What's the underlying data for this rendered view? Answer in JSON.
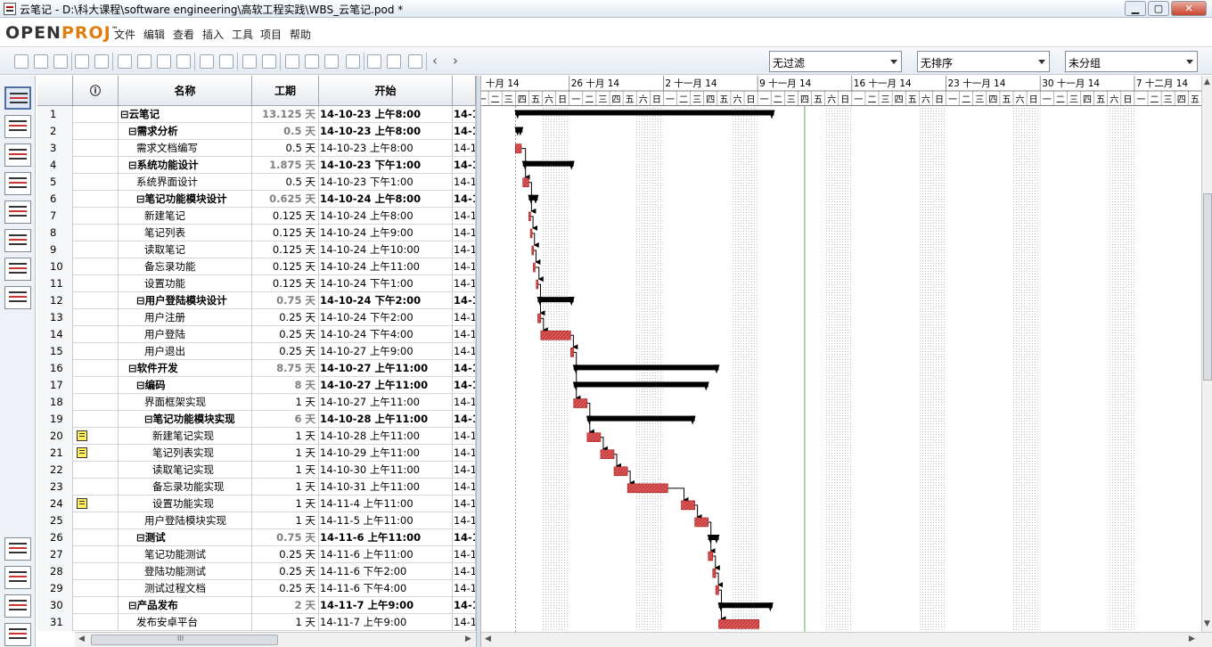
{
  "window": {
    "title": "云笔记 - D:\\科大课程\\software engineering\\高软工程实践\\WBS_云笔记.pod *",
    "min": "▁",
    "max": "▢",
    "close": "✕"
  },
  "app": {
    "logo_main": "OPEN",
    "logo_accent": "PROJ",
    "logo_tm": "™"
  },
  "menu": [
    "文件",
    "编辑",
    "查看",
    "插入",
    "工具",
    "项目",
    "帮助"
  ],
  "toolbar": {
    "filter": "无过滤",
    "sort": "无排序",
    "group": "未分组",
    "icons": [
      "new-file-icon",
      "open-folder-icon",
      "save-icon",
      "print-icon",
      "print-preview-icon",
      "cut-icon",
      "copy-icon",
      "paste-icon",
      "find-icon",
      "undo-icon",
      "redo-icon",
      "link-icon",
      "unlink-icon",
      "task-info-icon",
      "notes-icon",
      "assign-resource-icon",
      "calendar-icon",
      "zoom-in-icon",
      "zoom-out-icon",
      "scroll-to-task-icon"
    ],
    "prev": "‹",
    "next": "›"
  },
  "sidebar": [
    "gantt-view-icon",
    "network-view-icon",
    "resource-view-icon",
    "wbs-view-icon",
    "rbs-view-icon",
    "project-view-icon",
    "task-usage-icon",
    "resource-usage-icon",
    "histogram-icon",
    "charts-icon",
    "task-usage-detail-icon",
    "resource-usage-detail-icon"
  ],
  "table": {
    "headers": {
      "indicator": "ⓘ",
      "name": "名称",
      "duration": "工期",
      "start": "开始"
    },
    "rows": [
      {
        "id": "1",
        "name": "⊟云笔记",
        "indent": 0,
        "summary": true,
        "dur": "13.125 天",
        "start": "14-10-23 上午8:00",
        "finish": "14-1"
      },
      {
        "id": "2",
        "name": "⊟需求分析",
        "indent": 1,
        "summary": true,
        "dur": "0.5 天",
        "start": "14-10-23 上午8:00",
        "finish": "14-1"
      },
      {
        "id": "3",
        "name": "需求文档编写",
        "indent": 2,
        "dur": "0.5 天",
        "start": "14-10-23 上午8:00",
        "finish": "14-1"
      },
      {
        "id": "4",
        "name": "⊟系统功能设计",
        "indent": 1,
        "summary": true,
        "dur": "1.875 天",
        "start": "14-10-23 下午1:00",
        "finish": "14-1"
      },
      {
        "id": "5",
        "name": "系统界面设计",
        "indent": 2,
        "dur": "0.5 天",
        "start": "14-10-23 下午1:00",
        "finish": "14-1"
      },
      {
        "id": "6",
        "name": "⊟笔记功能模块设计",
        "indent": 2,
        "summary": true,
        "dur": "0.625 天",
        "start": "14-10-24 上午8:00",
        "finish": "14-1"
      },
      {
        "id": "7",
        "name": "新建笔记",
        "indent": 3,
        "dur": "0.125 天",
        "start": "14-10-24 上午8:00",
        "finish": "14-1"
      },
      {
        "id": "8",
        "name": "笔记列表",
        "indent": 3,
        "dur": "0.125 天",
        "start": "14-10-24 上午9:00",
        "finish": "14-1"
      },
      {
        "id": "9",
        "name": "读取笔记",
        "indent": 3,
        "dur": "0.125 天",
        "start": "14-10-24 上午10:00",
        "finish": "14-1"
      },
      {
        "id": "10",
        "name": "备忘录功能",
        "indent": 3,
        "dur": "0.125 天",
        "start": "14-10-24 上午11:00",
        "finish": "14-1"
      },
      {
        "id": "11",
        "name": "设置功能",
        "indent": 3,
        "dur": "0.125 天",
        "start": "14-10-24 下午1:00",
        "finish": "14-1"
      },
      {
        "id": "12",
        "name": "⊟用户登陆模块设计",
        "indent": 2,
        "summary": true,
        "dur": "0.75 天",
        "start": "14-10-24 下午2:00",
        "finish": "14-1"
      },
      {
        "id": "13",
        "name": "用户注册",
        "indent": 3,
        "dur": "0.25 天",
        "start": "14-10-24 下午2:00",
        "finish": "14-1"
      },
      {
        "id": "14",
        "name": "用户登陆",
        "indent": 3,
        "dur": "0.25 天",
        "start": "14-10-24 下午4:00",
        "finish": "14-1"
      },
      {
        "id": "15",
        "name": "用户退出",
        "indent": 3,
        "dur": "0.25 天",
        "start": "14-10-27 上午9:00",
        "finish": "14-1"
      },
      {
        "id": "16",
        "name": "⊟软件开发",
        "indent": 1,
        "summary": true,
        "dur": "8.75 天",
        "start": "14-10-27 上午11:00",
        "finish": "14-1"
      },
      {
        "id": "17",
        "name": "⊟编码",
        "indent": 2,
        "summary": true,
        "dur": "8 天",
        "start": "14-10-27 上午11:00",
        "finish": "14-1"
      },
      {
        "id": "18",
        "name": "界面框架实现",
        "indent": 3,
        "dur": "1 天",
        "start": "14-10-27 上午11:00",
        "finish": "14-1"
      },
      {
        "id": "19",
        "name": "⊟笔记功能模块实现",
        "indent": 3,
        "summary": true,
        "dur": "6 天",
        "start": "14-10-28 上午11:00",
        "finish": "14-1"
      },
      {
        "id": "20",
        "name": "新建笔记实现",
        "indent": 4,
        "dur": "1 天",
        "start": "14-10-28 上午11:00",
        "finish": "14-1",
        "note": true
      },
      {
        "id": "21",
        "name": "笔记列表实现",
        "indent": 4,
        "dur": "1 天",
        "start": "14-10-29 上午11:00",
        "finish": "14-1",
        "note": true
      },
      {
        "id": "22",
        "name": "读取笔记实现",
        "indent": 4,
        "dur": "1 天",
        "start": "14-10-30 上午11:00",
        "finish": "14-1"
      },
      {
        "id": "23",
        "name": "备忘录功能实现",
        "indent": 4,
        "dur": "1 天",
        "start": "14-10-31 上午11:00",
        "finish": "14-1"
      },
      {
        "id": "24",
        "name": "设置功能实现",
        "indent": 4,
        "dur": "1 天",
        "start": "14-11-4 上午11:00",
        "finish": "14-1",
        "note": true
      },
      {
        "id": "25",
        "name": "用户登陆模块实现",
        "indent": 3,
        "dur": "1 天",
        "start": "14-11-5 上午11:00",
        "finish": "14-1"
      },
      {
        "id": "26",
        "name": "⊟测试",
        "indent": 2,
        "summary": true,
        "dur": "0.75 天",
        "start": "14-11-6 上午11:00",
        "finish": "14-1"
      },
      {
        "id": "27",
        "name": "笔记功能测试",
        "indent": 3,
        "dur": "0.25 天",
        "start": "14-11-6 上午11:00",
        "finish": "14-1"
      },
      {
        "id": "28",
        "name": "登陆功能测试",
        "indent": 3,
        "dur": "0.25 天",
        "start": "14-11-6 下午2:00",
        "finish": "14-1"
      },
      {
        "id": "29",
        "name": "测试过程文档",
        "indent": 3,
        "dur": "0.25 天",
        "start": "14-11-6 下午4:00",
        "finish": "14-1"
      },
      {
        "id": "30",
        "name": "⊟产品发布",
        "indent": 1,
        "summary": true,
        "dur": "2 天",
        "start": "14-11-7 上午9:00",
        "finish": "14-1"
      },
      {
        "id": "31",
        "name": "发布安卓平台",
        "indent": 2,
        "dur": "1 天",
        "start": "14-11-7 上午9:00",
        "finish": "14-1"
      }
    ]
  },
  "gantt": {
    "weeks": [
      "十月 14",
      "26 十月 14",
      "2 十一月 14",
      "9 十一月 14",
      "16 十一月 14",
      "23 十一月 14",
      "30 十一月 14",
      "7 十二月 14"
    ],
    "day_labels": [
      "一",
      "二",
      "三",
      "四",
      "五",
      "六",
      "日"
    ],
    "colors": {
      "task": "#e05858",
      "summary": "#000000",
      "weekend": "#e4e4e4",
      "today": "#2a9a2a"
    },
    "bars": [
      {
        "row": 1,
        "type": "summary",
        "start": "2014-10-23 08:00",
        "end": "2014-11-11 10:00"
      },
      {
        "row": 2,
        "type": "summary",
        "start": "2014-10-23 08:00",
        "end": "2014-10-23 12:00"
      },
      {
        "row": 3,
        "type": "task",
        "start": "2014-10-23 08:00",
        "end": "2014-10-23 12:00"
      },
      {
        "row": 4,
        "type": "summary",
        "start": "2014-10-23 13:00",
        "end": "2014-10-27 11:00"
      },
      {
        "row": 5,
        "type": "task",
        "start": "2014-10-23 13:00",
        "end": "2014-10-23 17:00"
      },
      {
        "row": 6,
        "type": "summary",
        "start": "2014-10-24 08:00",
        "end": "2014-10-24 14:00"
      },
      {
        "row": 7,
        "type": "task",
        "start": "2014-10-24 08:00",
        "end": "2014-10-24 09:00"
      },
      {
        "row": 8,
        "type": "task",
        "start": "2014-10-24 09:00",
        "end": "2014-10-24 10:00"
      },
      {
        "row": 9,
        "type": "task",
        "start": "2014-10-24 10:00",
        "end": "2014-10-24 11:00"
      },
      {
        "row": 10,
        "type": "task",
        "start": "2014-10-24 11:00",
        "end": "2014-10-24 12:00"
      },
      {
        "row": 11,
        "type": "task",
        "start": "2014-10-24 13:00",
        "end": "2014-10-24 14:00"
      },
      {
        "row": 12,
        "type": "summary",
        "start": "2014-10-24 14:00",
        "end": "2014-10-27 11:00"
      },
      {
        "row": 13,
        "type": "task",
        "start": "2014-10-24 14:00",
        "end": "2014-10-24 16:00"
      },
      {
        "row": 14,
        "type": "task",
        "start": "2014-10-24 16:00",
        "end": "2014-10-27 09:00"
      },
      {
        "row": 15,
        "type": "task",
        "start": "2014-10-27 09:00",
        "end": "2014-10-27 11:00"
      },
      {
        "row": 16,
        "type": "summary",
        "start": "2014-10-27 11:00",
        "end": "2014-11-07 09:00"
      },
      {
        "row": 17,
        "type": "summary",
        "start": "2014-10-27 11:00",
        "end": "2014-11-06 11:00"
      },
      {
        "row": 18,
        "type": "task",
        "start": "2014-10-27 11:00",
        "end": "2014-10-28 11:00"
      },
      {
        "row": 19,
        "type": "summary",
        "start": "2014-10-28 11:00",
        "end": "2014-11-05 11:00"
      },
      {
        "row": 20,
        "type": "task",
        "start": "2014-10-28 11:00",
        "end": "2014-10-29 11:00"
      },
      {
        "row": 21,
        "type": "task",
        "start": "2014-10-29 11:00",
        "end": "2014-10-30 11:00"
      },
      {
        "row": 22,
        "type": "task",
        "start": "2014-10-30 11:00",
        "end": "2014-10-31 11:00"
      },
      {
        "row": 23,
        "type": "task",
        "start": "2014-10-31 11:00",
        "end": "2014-11-03 11:00"
      },
      {
        "row": 24,
        "type": "task",
        "start": "2014-11-04 11:00",
        "end": "2014-11-05 11:00"
      },
      {
        "row": 25,
        "type": "task",
        "start": "2014-11-05 11:00",
        "end": "2014-11-06 11:00"
      },
      {
        "row": 26,
        "type": "summary",
        "start": "2014-11-06 11:00",
        "end": "2014-11-07 09:00"
      },
      {
        "row": 27,
        "type": "task",
        "start": "2014-11-06 11:00",
        "end": "2014-11-06 14:00"
      },
      {
        "row": 28,
        "type": "task",
        "start": "2014-11-06 14:00",
        "end": "2014-11-06 16:00"
      },
      {
        "row": 29,
        "type": "task",
        "start": "2014-11-06 16:00",
        "end": "2014-11-07 09:00"
      },
      {
        "row": 30,
        "type": "summary",
        "start": "2014-11-07 09:00",
        "end": "2014-11-11 09:00"
      },
      {
        "row": 31,
        "type": "task",
        "start": "2014-11-07 09:00",
        "end": "2014-11-10 09:00"
      }
    ]
  }
}
